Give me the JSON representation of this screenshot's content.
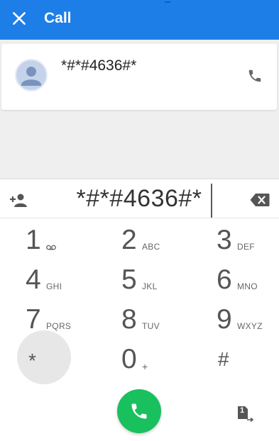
{
  "header": {
    "title": "Call",
    "close_icon": "close-icon"
  },
  "contact": {
    "number": "*#*#4636#*",
    "avatar_icon": "person-icon",
    "call_icon": "phone-icon"
  },
  "dialer": {
    "input_value": "*#*#4636#*",
    "add_contact_icon": "add-contact-icon",
    "backspace_icon": "backspace-icon",
    "keys": [
      {
        "digit": "1",
        "letters": ""
      },
      {
        "digit": "2",
        "letters": "ABC"
      },
      {
        "digit": "3",
        "letters": "DEF"
      },
      {
        "digit": "4",
        "letters": "GHI"
      },
      {
        "digit": "5",
        "letters": "JKL"
      },
      {
        "digit": "6",
        "letters": "MNO"
      },
      {
        "digit": "7",
        "letters": "PQRS"
      },
      {
        "digit": "8",
        "letters": "TUV"
      },
      {
        "digit": "9",
        "letters": "WXYZ"
      },
      {
        "digit": "*",
        "letters": ""
      },
      {
        "digit": "0",
        "letters": "+"
      },
      {
        "digit": "#",
        "letters": ""
      }
    ],
    "voicemail_icon": "voicemail-icon",
    "call_button_icon": "phone-icon",
    "sim_label": "1"
  },
  "colors": {
    "appbar": "#1e7ee8",
    "call_button": "#19c05e"
  }
}
